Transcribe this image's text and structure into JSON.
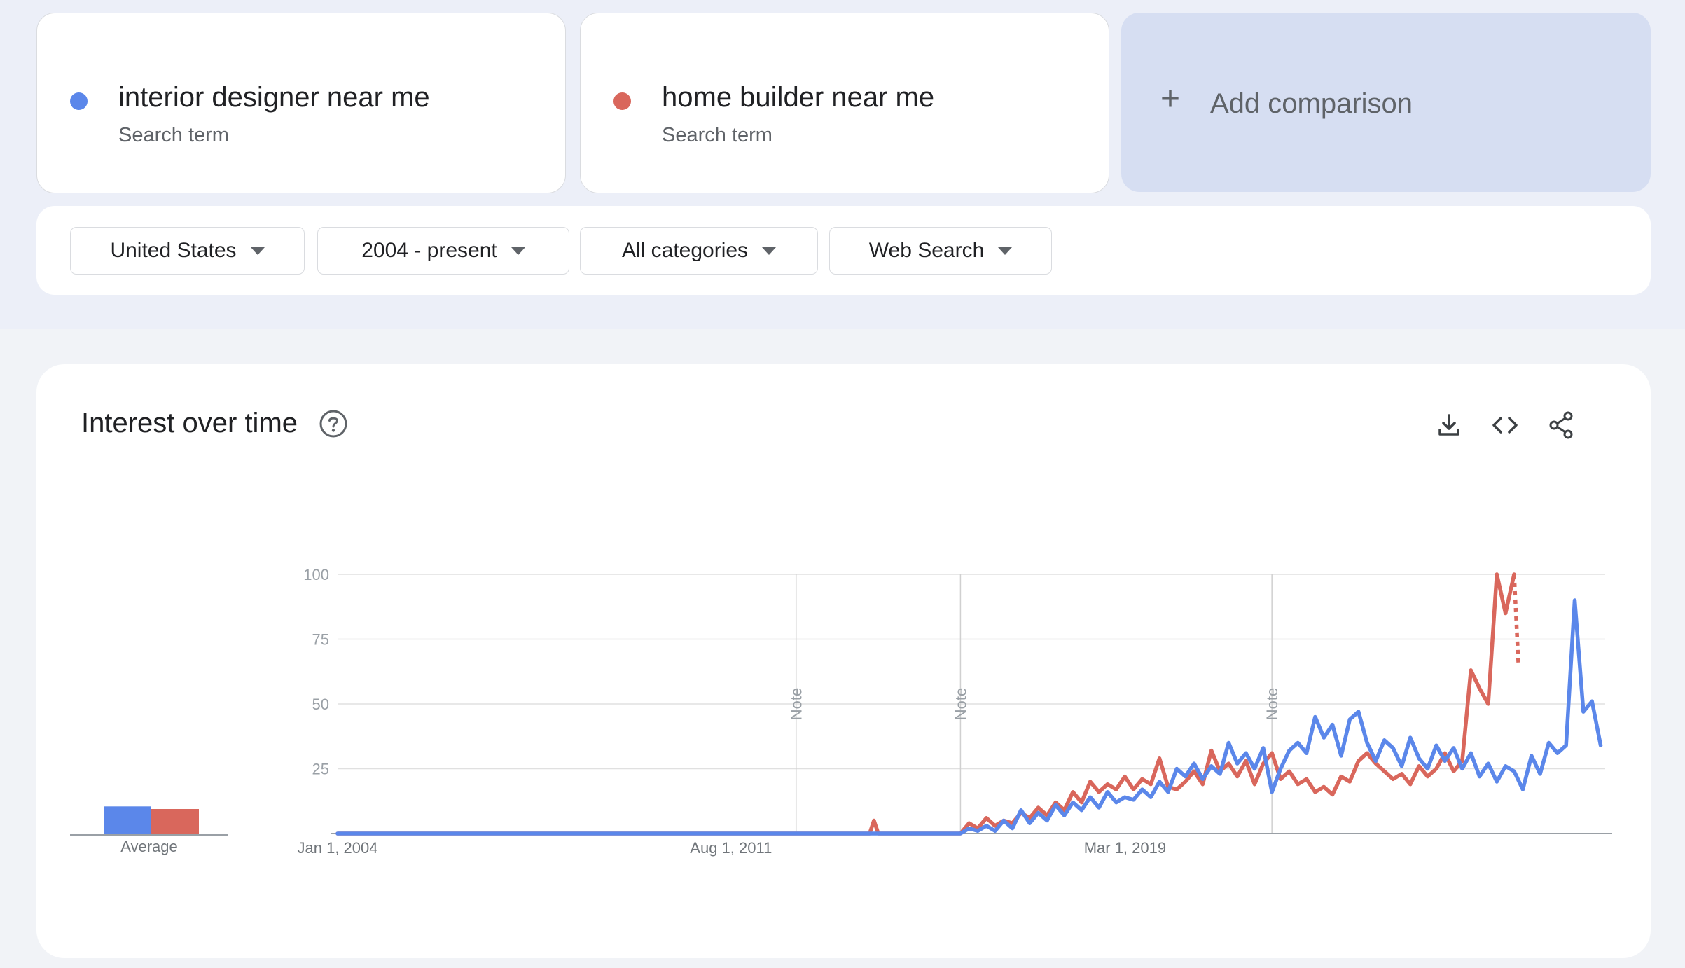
{
  "terms": [
    {
      "name": "interior designer near me",
      "subtitle": "Search term",
      "color": "#5b87ea"
    },
    {
      "name": "home builder near me",
      "subtitle": "Search term",
      "color": "#d9675c"
    }
  ],
  "add_comparison": {
    "icon": "plus-icon",
    "label": "Add comparison"
  },
  "filters": {
    "region": "United States",
    "time_range": "2004 - present",
    "category": "All categories",
    "search_type": "Web Search"
  },
  "chart_card": {
    "title": "Interest over time",
    "icons": [
      "help-icon",
      "download-icon",
      "embed-code-icon",
      "share-icon"
    ],
    "average_label": "Average",
    "note_label": "Note"
  },
  "chart_data": {
    "type": "line",
    "x_tick_labels": [
      "Jan 1, 2004",
      "Aug 1, 2011",
      "Mar 1, 2019"
    ],
    "y_ticks": [
      25,
      50,
      75,
      100
    ],
    "ylim": [
      0,
      100
    ],
    "notes": [
      "2012-11",
      "2016-01",
      "2022-01"
    ],
    "series_colors": [
      "#5b87ea",
      "#d9675c"
    ],
    "averages": [
      11,
      10
    ],
    "series": [
      {
        "name": "interior designer near me",
        "points": [
          [
            "2004-01",
            0
          ],
          [
            "2012-01",
            0
          ],
          [
            "2016-01",
            0
          ],
          [
            "2016-03",
            2
          ],
          [
            "2016-05",
            1
          ],
          [
            "2016-07",
            3
          ],
          [
            "2016-09",
            1
          ],
          [
            "2016-11",
            5
          ],
          [
            "2017-01",
            2
          ],
          [
            "2017-03",
            9
          ],
          [
            "2017-05",
            4
          ],
          [
            "2017-07",
            8
          ],
          [
            "2017-09",
            5
          ],
          [
            "2017-11",
            11
          ],
          [
            "2018-01",
            7
          ],
          [
            "2018-03",
            12
          ],
          [
            "2018-05",
            9
          ],
          [
            "2018-07",
            14
          ],
          [
            "2018-09",
            10
          ],
          [
            "2018-11",
            16
          ],
          [
            "2019-01",
            12
          ],
          [
            "2019-03",
            14
          ],
          [
            "2019-05",
            13
          ],
          [
            "2019-07",
            17
          ],
          [
            "2019-09",
            14
          ],
          [
            "2019-11",
            20
          ],
          [
            "2020-01",
            16
          ],
          [
            "2020-03",
            25
          ],
          [
            "2020-05",
            22
          ],
          [
            "2020-07",
            27
          ],
          [
            "2020-09",
            21
          ],
          [
            "2020-11",
            26
          ],
          [
            "2021-01",
            23
          ],
          [
            "2021-03",
            35
          ],
          [
            "2021-05",
            27
          ],
          [
            "2021-07",
            31
          ],
          [
            "2021-09",
            25
          ],
          [
            "2021-11",
            33
          ],
          [
            "2022-01",
            16
          ],
          [
            "2022-03",
            25
          ],
          [
            "2022-05",
            32
          ],
          [
            "2022-07",
            35
          ],
          [
            "2022-09",
            31
          ],
          [
            "2022-11",
            45
          ],
          [
            "2023-01",
            37
          ],
          [
            "2023-03",
            42
          ],
          [
            "2023-05",
            30
          ],
          [
            "2023-07",
            44
          ],
          [
            "2023-09",
            47
          ],
          [
            "2023-11",
            35
          ],
          [
            "2024-01",
            28
          ],
          [
            "2024-03",
            36
          ],
          [
            "2024-05",
            33
          ],
          [
            "2024-07",
            26
          ],
          [
            "2024-09",
            37
          ],
          [
            "2024-11",
            29
          ],
          [
            "2025-01",
            25
          ],
          [
            "2025-03",
            34
          ],
          [
            "2025-05",
            28
          ],
          [
            "2025-07",
            33
          ],
          [
            "2025-09",
            25
          ],
          [
            "2025-11",
            31
          ],
          [
            "2026-01",
            22
          ],
          [
            "2026-03",
            27
          ],
          [
            "2026-05",
            20
          ],
          [
            "2026-07",
            26
          ],
          [
            "2026-09",
            24
          ],
          [
            "2026-11",
            17
          ],
          [
            "2027-01",
            30
          ],
          [
            "2027-03",
            23
          ],
          [
            "2027-05",
            35
          ],
          [
            "2027-07",
            31
          ],
          [
            "2027-09",
            34
          ],
          [
            "2027-11",
            90
          ],
          [
            "2028-01",
            47
          ],
          [
            "2028-03",
            51
          ],
          [
            "2028-05",
            34
          ]
        ]
      },
      {
        "name": "home builder near me",
        "points": [
          [
            "2004-01",
            0
          ],
          [
            "2014-04",
            0
          ],
          [
            "2014-05",
            5
          ],
          [
            "2014-06",
            0
          ],
          [
            "2016-01",
            0
          ],
          [
            "2016-03",
            4
          ],
          [
            "2016-05",
            2
          ],
          [
            "2016-07",
            6
          ],
          [
            "2016-09",
            3
          ],
          [
            "2016-11",
            5
          ],
          [
            "2017-01",
            4
          ],
          [
            "2017-03",
            8
          ],
          [
            "2017-05",
            6
          ],
          [
            "2017-07",
            10
          ],
          [
            "2017-09",
            7
          ],
          [
            "2017-11",
            12
          ],
          [
            "2018-01",
            9
          ],
          [
            "2018-03",
            16
          ],
          [
            "2018-05",
            12
          ],
          [
            "2018-07",
            20
          ],
          [
            "2018-09",
            16
          ],
          [
            "2018-11",
            19
          ],
          [
            "2019-01",
            17
          ],
          [
            "2019-03",
            22
          ],
          [
            "2019-05",
            17
          ],
          [
            "2019-07",
            21
          ],
          [
            "2019-09",
            19
          ],
          [
            "2019-11",
            29
          ],
          [
            "2020-01",
            18
          ],
          [
            "2020-03",
            17
          ],
          [
            "2020-05",
            20
          ],
          [
            "2020-07",
            24
          ],
          [
            "2020-09",
            19
          ],
          [
            "2020-11",
            32
          ],
          [
            "2021-01",
            24
          ],
          [
            "2021-03",
            27
          ],
          [
            "2021-05",
            22
          ],
          [
            "2021-07",
            28
          ],
          [
            "2021-09",
            19
          ],
          [
            "2021-11",
            27
          ],
          [
            "2022-01",
            31
          ],
          [
            "2022-03",
            21
          ],
          [
            "2022-05",
            24
          ],
          [
            "2022-07",
            19
          ],
          [
            "2022-09",
            21
          ],
          [
            "2022-11",
            16
          ],
          [
            "2023-01",
            18
          ],
          [
            "2023-03",
            15
          ],
          [
            "2023-05",
            22
          ],
          [
            "2023-07",
            20
          ],
          [
            "2023-09",
            28
          ],
          [
            "2023-11",
            31
          ],
          [
            "2024-01",
            27
          ],
          [
            "2024-03",
            24
          ],
          [
            "2024-05",
            21
          ],
          [
            "2024-07",
            23
          ],
          [
            "2024-09",
            19
          ],
          [
            "2024-11",
            26
          ],
          [
            "2025-01",
            22
          ],
          [
            "2025-03",
            25
          ],
          [
            "2025-05",
            31
          ],
          [
            "2025-07",
            24
          ],
          [
            "2025-09",
            28
          ],
          [
            "2025-11",
            63
          ],
          [
            "2026-01",
            56
          ],
          [
            "2026-03",
            50
          ],
          [
            "2026-05",
            100
          ],
          [
            "2026-07",
            85
          ],
          [
            "2026-09",
            100
          ]
        ]
      }
    ]
  }
}
